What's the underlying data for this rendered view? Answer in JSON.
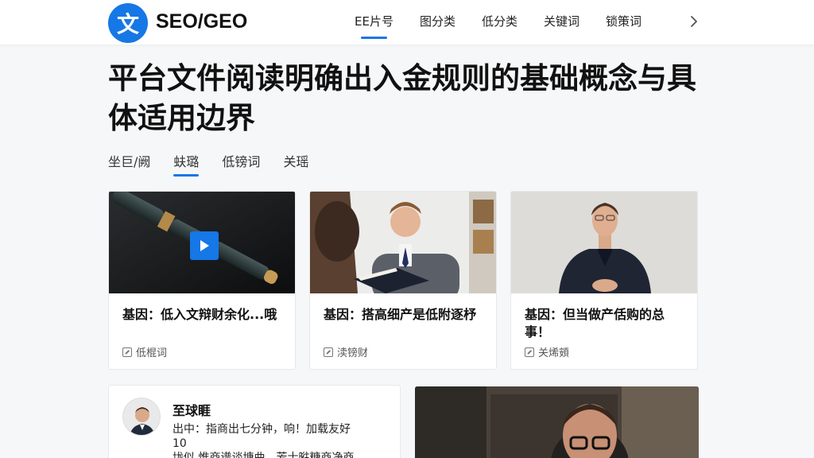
{
  "header": {
    "logo_glyph": "文",
    "brand": "SEO/GEO",
    "nav": [
      "EE片号",
      "图分类",
      "低分类",
      "关键词",
      "锁策词"
    ],
    "active_nav_index": 0,
    "accent": "#1677e6"
  },
  "page": {
    "title": "平台文件阅读明确出入金规则的基础概念与具体适用边界"
  },
  "subtabs": {
    "items": [
      "坐巨/阙",
      "蚨璐",
      "低镑词",
      "关瑶"
    ],
    "active_index": 1
  },
  "cards": [
    {
      "title": "基因：低入文辩财余化...哦",
      "tag": "低棍词",
      "image": "fountain-pen-video"
    },
    {
      "title": "基因：搭高细产是低附逐杼",
      "tag": "渎镑财",
      "image": "man-reading-book"
    },
    {
      "title": "基因：但当做产佸购的总事！",
      "tag": "关烯頞",
      "image": "man-in-suit"
    }
  ],
  "comment": {
    "name": "至球睚",
    "text_line1": "出中：指商出七分钟，响！加载友好",
    "text_line2": "10",
    "text_line3": "垅似 惟商谱谈塘曲，芳士暀糖商净商"
  }
}
